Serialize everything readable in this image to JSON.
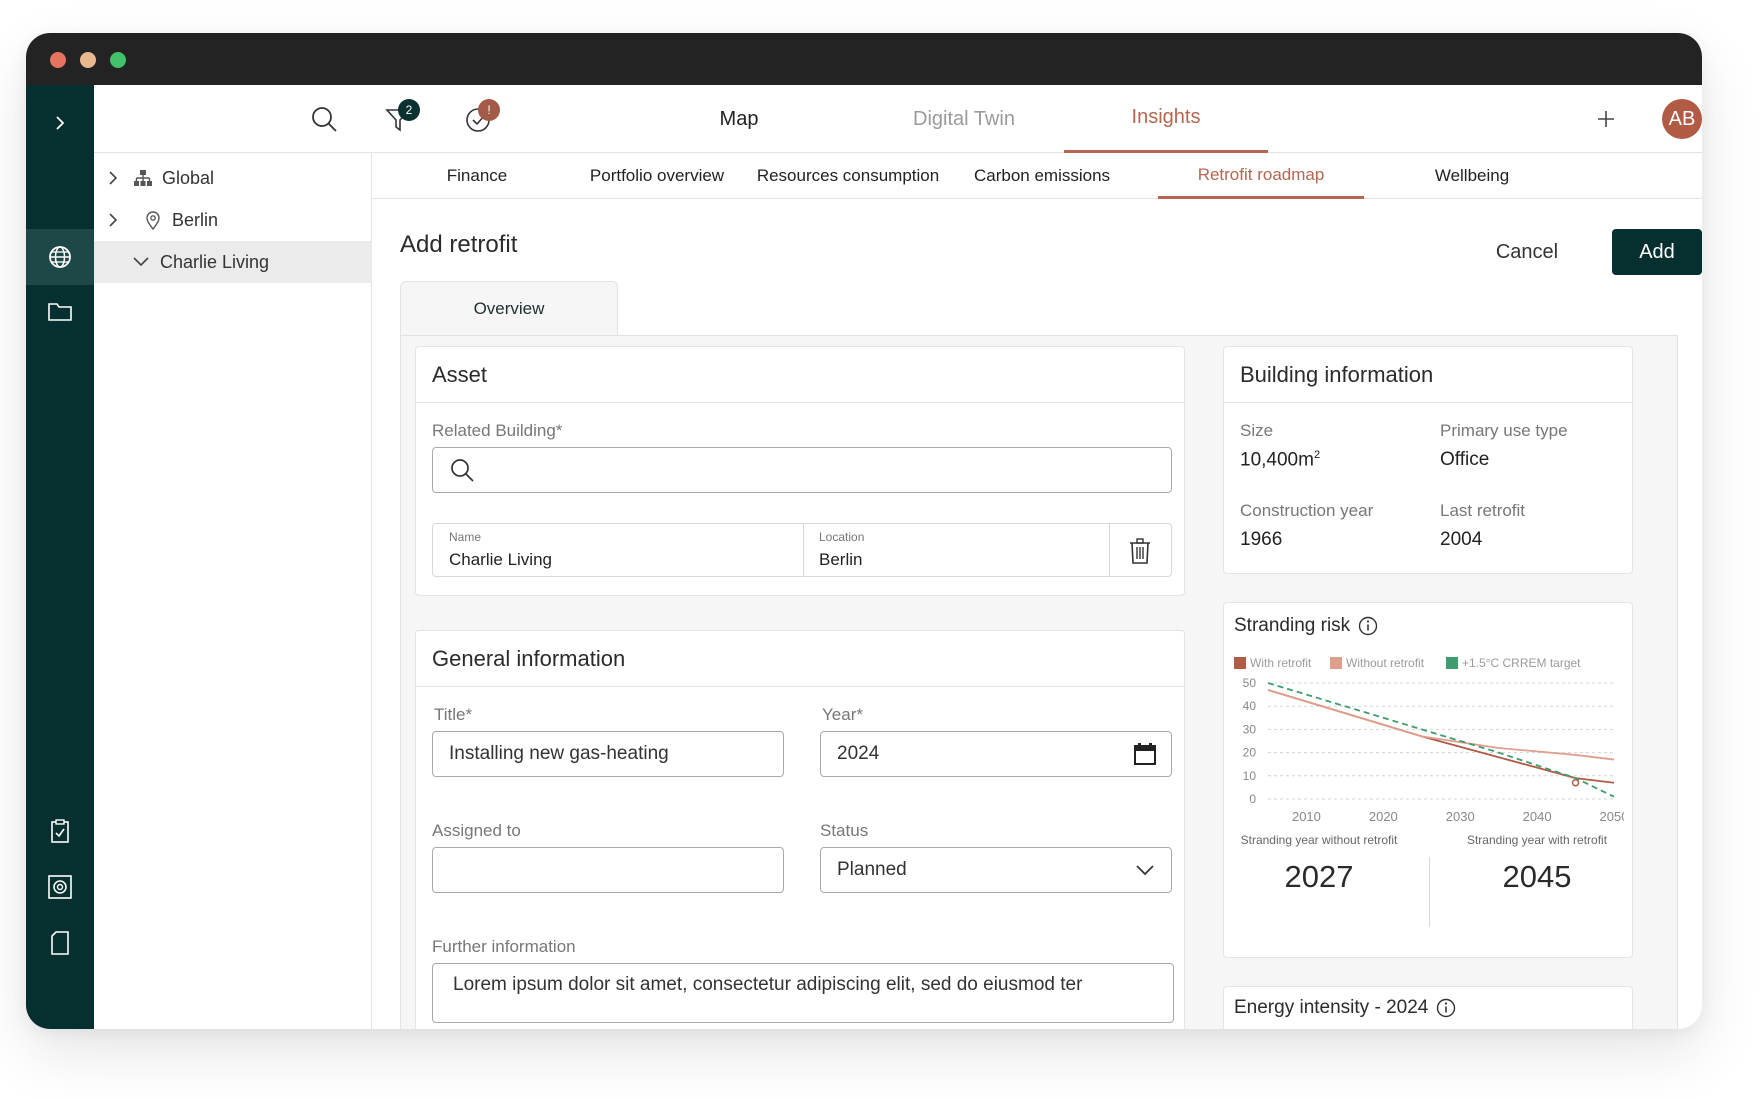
{
  "header": {
    "filter_badge": "2",
    "alert_badge": "!",
    "nav": [
      "Map",
      "Digital Twin",
      "Insights"
    ],
    "avatar_initials": "AB"
  },
  "tree": [
    {
      "label": "Global",
      "icon": "hierarchy-icon"
    },
    {
      "label": "Berlin",
      "icon": "location-pin-icon"
    },
    {
      "label": "Charlie Living",
      "icon": ""
    }
  ],
  "subtabs": [
    "Finance",
    "Portfolio overview",
    "Resources consumption",
    "Carbon emissions",
    "Retrofit roadmap",
    "Wellbeing"
  ],
  "page": {
    "title": "Add retrofit",
    "cancel_label": "Cancel",
    "add_label": "Add",
    "overview_tab": "Overview"
  },
  "asset": {
    "title": "Asset",
    "related_building_label": "Related Building*",
    "related_building_value": "",
    "name_label": "Name",
    "name_value": "Charlie Living",
    "location_label": "Location",
    "location_value": "Berlin"
  },
  "general": {
    "title": "General information",
    "title_label": "Title*",
    "title_value": "Installing new gas-heating",
    "year_label": "Year*",
    "year_value": "2024",
    "assigned_label": "Assigned to",
    "assigned_value": "",
    "status_label": "Status",
    "status_value": "Planned",
    "further_label": "Further information",
    "further_value": "Lorem ipsum dolor sit amet, consectetur adipiscing elit, sed do eiusmod ter"
  },
  "building_info": {
    "title": "Building information",
    "size_label": "Size",
    "size_value": "10,400m",
    "size_unit_sup": "2",
    "use_label": "Primary use type",
    "use_value": "Office",
    "construction_label": "Construction year",
    "construction_value": "1966",
    "retrofit_label": "Last retrofit",
    "retrofit_value": "2004"
  },
  "stranding": {
    "title": "Stranding risk",
    "stranding_without_label": "Stranding year without retrofit",
    "stranding_without_value": "2027",
    "stranding_with_label": "Stranding year with retrofit",
    "stranding_with_value": "2045"
  },
  "energy": {
    "title": "Energy intensity - 2024"
  },
  "colors": {
    "accent": "#b56650",
    "rail": "#06302f",
    "with_retrofit": "#b15a44",
    "without_retrofit": "#df9f8c",
    "crrem_target": "#3e9c6f"
  },
  "chart_data": {
    "type": "line",
    "title": "Stranding risk",
    "xlim": [
      2005,
      2050
    ],
    "ylim": [
      0,
      50
    ],
    "x_ticks": [
      2010,
      2020,
      2030,
      2040,
      2050
    ],
    "y_ticks": [
      0,
      10,
      20,
      30,
      40,
      50
    ],
    "grid": true,
    "legend_position": "top",
    "series": [
      {
        "name": "With retrofit",
        "color": "#b15a44",
        "dash": false,
        "x": [
          2005,
          2015,
          2025,
          2035,
          2045,
          2050
        ],
        "y": [
          47,
          37,
          27,
          18,
          9,
          7
        ],
        "marker": {
          "x": 2045,
          "y": 7
        }
      },
      {
        "name": "Without retrofit",
        "color": "#df9f8c",
        "dash": false,
        "x": [
          2005,
          2015,
          2025,
          2035,
          2045,
          2050
        ],
        "y": [
          47,
          37,
          27,
          22,
          19,
          17
        ]
      },
      {
        "name": "+1.5°C CRREM target",
        "color": "#3e9c6f",
        "dash": true,
        "x": [
          2005,
          2015,
          2025,
          2035,
          2045,
          2050
        ],
        "y": [
          50,
          40,
          30,
          20,
          9,
          1
        ]
      }
    ]
  }
}
